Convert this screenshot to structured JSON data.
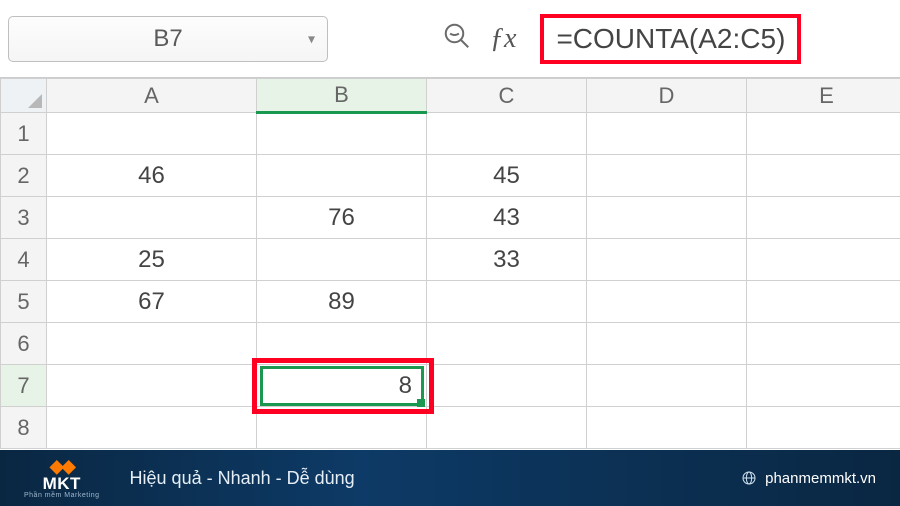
{
  "name_box": "B7",
  "formula_bar": "=COUNTA(A2:C5)",
  "columns": [
    "A",
    "B",
    "C",
    "D",
    "E"
  ],
  "rows": [
    "1",
    "2",
    "3",
    "4",
    "5",
    "6",
    "7",
    "8"
  ],
  "cells": {
    "A2": "46",
    "C2": "45",
    "B3": "76",
    "C3": "43",
    "A4": "25",
    "C4": "33",
    "A5": "67",
    "B5": "89",
    "B7": "8"
  },
  "active_cell": "B7",
  "footer": {
    "logo_text": "MKT",
    "logo_sub": "Phần mềm Marketing",
    "tagline": "Hiệu quả - Nhanh  - Dễ dùng",
    "site": "phanmemmkt.vn"
  }
}
